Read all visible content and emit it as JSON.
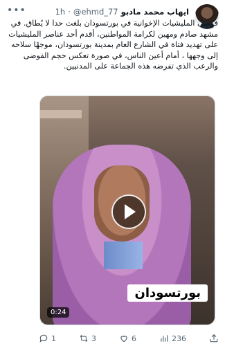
{
  "author": {
    "name": "ايهاب محمد مادبو",
    "handle": "@ehmd_77",
    "dot": "·",
    "time": "1h"
  },
  "tweet": {
    "text": "فوضى المليشيات الإخوانية في بورتسودان بلغت حدا لا يُطاق. في مشهد صادم ومهين لكرامة المواطنين، أقدم أحد عناصر المليشيات على تهديد فتاة في الشارع العام بمدينة بورتسودان، موجهًا سلاحه إلى وجهها ، أمام أعين الناس، في صورة تعكس حجم الفوضى والرعب الذي تفرضه هذه الجماعة على المدنيين."
  },
  "media": {
    "caption": "بورتسودان",
    "duration": "0:24"
  },
  "actions": {
    "replies": "1",
    "retweets": "3",
    "likes": "6",
    "views": "236"
  },
  "icons": {
    "more": "more-icon",
    "play": "play-icon",
    "reply": "reply-icon",
    "retweet": "retweet-icon",
    "like": "heart-icon",
    "views": "views-icon",
    "share": "share-icon"
  }
}
